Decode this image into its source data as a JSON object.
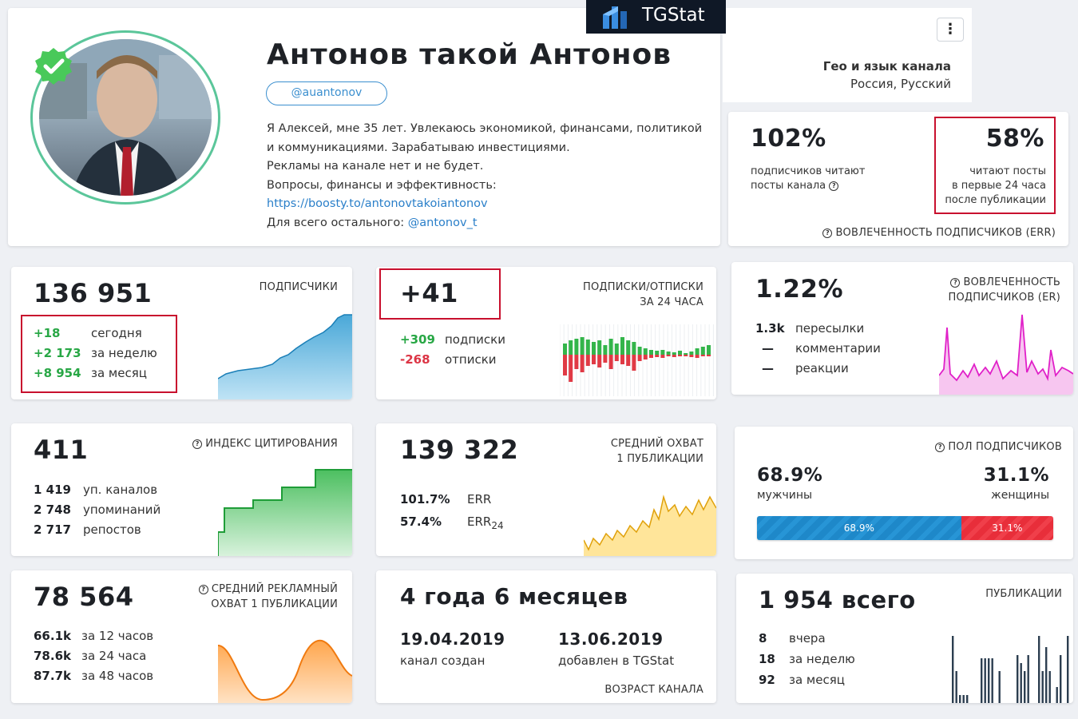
{
  "brand": {
    "name": "TGStat"
  },
  "channel": {
    "title": "Антонов такой Антонов",
    "username": "@auantonov",
    "description": [
      "Я Алексей, мне 35 лет. Увлекаюсь экономикой, финансами, политикой",
      "и коммуникациями. Зарабатываю инвестициями.",
      "Рекламы на канале нет и не будет.",
      "Вопросы, финансы и эффективность:"
    ],
    "link": "https://boosty.to/antonovtakoiantonov",
    "other_prefix": "Для всего остального:",
    "other_handle": "@antonov_t",
    "geo_title": "Гео и язык канала",
    "geo_value": "Россия, Русский"
  },
  "err_card": {
    "left_value": "102%",
    "left_label_1": "подписчиков читают",
    "left_label_2": "посты канала",
    "right_value": "58%",
    "right_label": [
      "читают посты",
      "в первые 24 часа",
      "после публикации"
    ],
    "footer": "ВОВЛЕЧЕННОСТЬ ПОДПИСЧИКОВ (ERR)"
  },
  "subscribers": {
    "value": "136 951",
    "label": "ПОДПИСЧИКИ",
    "rows": [
      {
        "num": "+18",
        "text": "сегодня"
      },
      {
        "num": "+2 173",
        "text": "за неделю"
      },
      {
        "num": "+8 954",
        "text": "за месяц"
      }
    ]
  },
  "subs_unsubs": {
    "value": "+41",
    "label_1": "ПОДПИСКИ/ОТПИСКИ",
    "label_2": "ЗА 24 ЧАСА",
    "rows": [
      {
        "num": "+309",
        "text": "подписки"
      },
      {
        "num": "-268",
        "text": "отписки"
      }
    ]
  },
  "er_card": {
    "value": "1.22%",
    "label_1": "ВОВЛЕЧЕННОСТЬ",
    "label_2": "ПОДПИСЧИКОВ (ER)",
    "rows": [
      {
        "num": "1.3k",
        "text": "пересылки"
      },
      {
        "num": "—",
        "text": "комментарии"
      },
      {
        "num": "—",
        "text": "реакции"
      }
    ]
  },
  "citation": {
    "value": "411",
    "label": "ИНДЕКС ЦИТИРОВАНИЯ",
    "rows": [
      {
        "num": "1 419",
        "text": "уп. каналов"
      },
      {
        "num": "2 748",
        "text": "упоминаний"
      },
      {
        "num": "2 717",
        "text": "репостов"
      }
    ]
  },
  "reach": {
    "value": "139 322",
    "label_1": "СРЕДНИЙ ОХВАТ",
    "label_2": "1 ПУБЛИКАЦИИ",
    "rows": [
      {
        "num": "101.7%",
        "text": "ERR"
      },
      {
        "num": "57.4%",
        "text": "ERR",
        "sub": "24"
      }
    ]
  },
  "gender": {
    "label": "ПОЛ ПОДПИСЧИКОВ",
    "male_value": "68.9%",
    "male_label": "мужчины",
    "female_value": "31.1%",
    "female_label": "женщины",
    "male_share": 68.9,
    "female_share": 31.1,
    "male_bar": "68.9%",
    "female_bar": "31.1%",
    "male_color": "#1e88c9",
    "female_color": "#e82e3a"
  },
  "ad_reach": {
    "value": "78 564",
    "label_1": "СРЕДНИЙ РЕКЛАМНЫЙ",
    "label_2": "ОХВАТ 1 ПУБЛИКАЦИИ",
    "rows": [
      {
        "num": "66.1k",
        "text": "за 12 часов"
      },
      {
        "num": "78.6k",
        "text": "за 24 часа"
      },
      {
        "num": "87.7k",
        "text": "за 48 часов"
      }
    ]
  },
  "age": {
    "value": "4 года 6 месяцев",
    "created_date": "19.04.2019",
    "created_label": "канал создан",
    "added_date": "13.06.2019",
    "added_label": "добавлен в TGStat",
    "footer": "ВОЗРАСТ КАНАЛА"
  },
  "posts": {
    "value": "1 954 всего",
    "label": "ПУБЛИКАЦИИ",
    "rows": [
      {
        "num": "8",
        "text": "вчера"
      },
      {
        "num": "18",
        "text": "за неделю"
      },
      {
        "num": "92",
        "text": "за месяц"
      }
    ]
  }
}
